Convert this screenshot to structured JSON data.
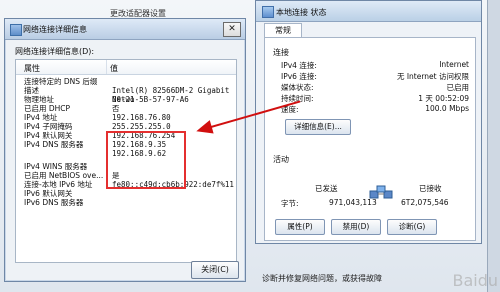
{
  "background": {
    "header_text": "更改适配器设置",
    "bottom_text": "诊断并修复网络问题，或获得故障"
  },
  "left_dialog": {
    "title": "网络连接详细信息",
    "close_glyph": "✕",
    "details_label": "网络连接详细信息(D):",
    "columns": [
      "属性",
      "值"
    ],
    "rows": [
      {
        "property": "连接特定的 DNS 后缀",
        "value": ""
      },
      {
        "property": "描述",
        "value": "Intel(R) 82566DM-2 Gigabit Netwo"
      },
      {
        "property": "物理地址",
        "value": "00-21-5B-57-97-A6"
      },
      {
        "property": "已启用 DHCP",
        "value": "否"
      },
      {
        "property": "IPv4 地址",
        "value": "192.168.76.80"
      },
      {
        "property": "IPv4 子网掩码",
        "value": "255.255.255.0"
      },
      {
        "property": "IPv4 默认网关",
        "value": "192.168.76.254"
      },
      {
        "property": "IPv4 DNS 服务器",
        "value": "192.168.9.35"
      },
      {
        "property": "",
        "value": "192.168.9.62"
      },
      {
        "property": "IPv4 WINS 服务器",
        "value": ""
      },
      {
        "property": "已启用 NetBIOS ove...",
        "value": "是"
      },
      {
        "property": "连接-本地 IPv6 地址",
        "value": "fe80::c49d:cb6b:922:de7f%11"
      },
      {
        "property": "IPv6 默认网关",
        "value": ""
      },
      {
        "property": "IPv6 DNS 服务器",
        "value": ""
      }
    ],
    "close_button": "关闭(C)"
  },
  "status_window": {
    "title": "本地连接 状态",
    "tab": "常规",
    "connection_title": "连接",
    "rows": [
      {
        "label": "IPv4 连接:",
        "value": "Internet"
      },
      {
        "label": "IPv6 连接:",
        "value": "无 Internet 访问权限"
      },
      {
        "label": "媒体状态:",
        "value": "已启用"
      },
      {
        "label": "持续时间:",
        "value": "1 天 00:52:09"
      },
      {
        "label": "速度:",
        "value": "100.0 Mbps"
      }
    ],
    "details_button": "详细信息(E)...",
    "activity_title": "活动",
    "sent_label": "已发送",
    "received_label": "已接收",
    "bytes_label": "字节:",
    "sent_bytes": "971,043,113",
    "received_bytes": "6T2,075,546",
    "buttons": {
      "properties": "属性(P)",
      "disable": "禁用(D)",
      "diagnose": "诊断(G)"
    }
  },
  "watermark": "Baidu"
}
